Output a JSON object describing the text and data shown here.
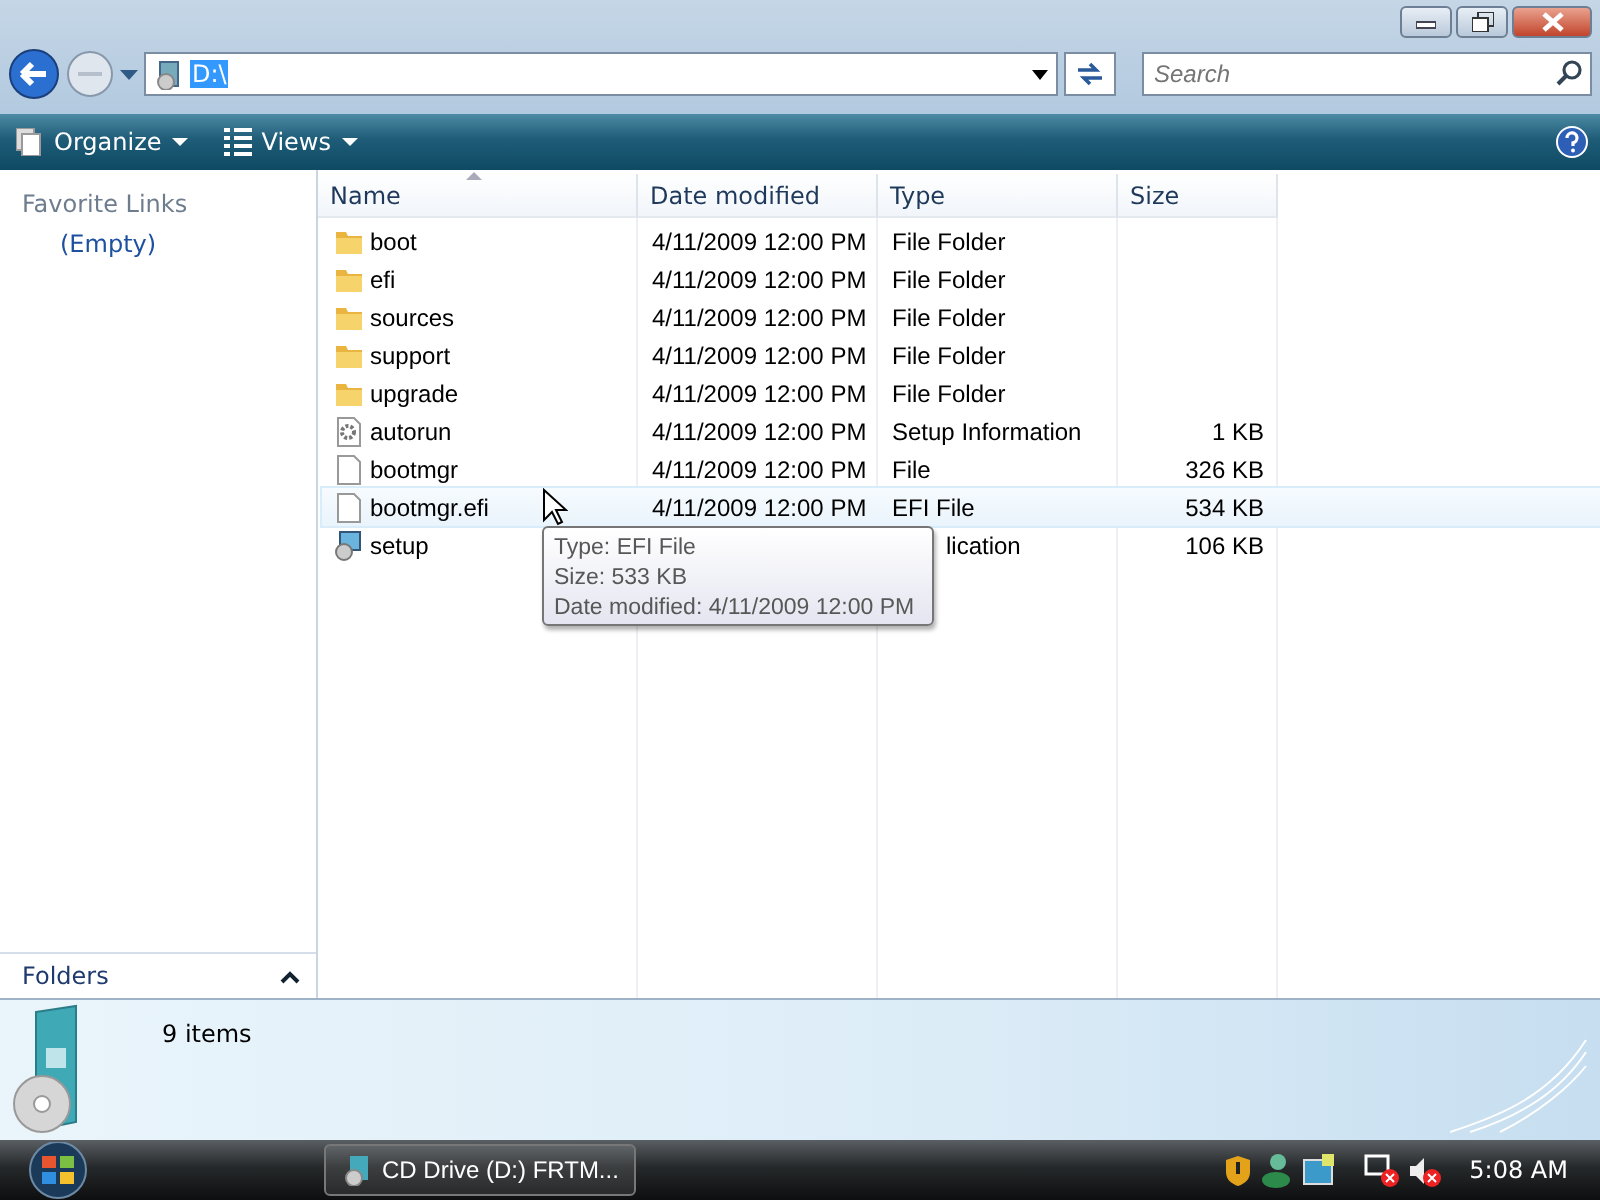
{
  "address": {
    "value": "D:\\"
  },
  "search": {
    "placeholder": "Search"
  },
  "toolbar": [
    {
      "label": "Organize",
      "kind": "organize"
    },
    {
      "label": "Views",
      "kind": "views"
    }
  ],
  "nav": {
    "heading": "Favorite Links",
    "items": [
      "(Empty)"
    ],
    "folders_label": "Folders"
  },
  "table": {
    "columns": [
      "Name",
      "Date modified",
      "Type",
      "Size"
    ],
    "rows": [
      {
        "name": "boot",
        "kind": "folder",
        "date": "4/11/2009 12:00 PM",
        "type": "File Folder",
        "hovered": false
      },
      {
        "name": "efi",
        "kind": "folder",
        "date": "4/11/2009 12:00 PM",
        "type": "File Folder",
        "hovered": false
      },
      {
        "name": "sources",
        "kind": "folder",
        "date": "4/11/2009 12:00 PM",
        "type": "File Folder",
        "hovered": false
      },
      {
        "name": "support",
        "kind": "folder",
        "date": "4/11/2009 12:00 PM",
        "type": "File Folder",
        "hovered": false
      },
      {
        "name": "upgrade",
        "kind": "folder",
        "date": "4/11/2009 12:00 PM",
        "type": "File Folder",
        "hovered": false
      },
      {
        "name": "autorun",
        "kind": "settings",
        "date": "4/11/2009 12:00 PM",
        "type": "Setup Information",
        "size": "1 KB",
        "hovered": false
      },
      {
        "name": "bootmgr",
        "kind": "file",
        "date": "4/11/2009 12:00 PM",
        "type": "File",
        "size": "326 KB",
        "hovered": false
      },
      {
        "name": "bootmgr.efi",
        "kind": "file",
        "date": "4/11/2009 12:00 PM",
        "type": "EFI File",
        "size": "534 KB",
        "hovered": true
      },
      {
        "name": "setup",
        "kind": "app",
        "type": "lication",
        "size": "106 KB",
        "hovered": false
      }
    ]
  },
  "tooltip": [
    "Type: EFI File",
    "Size: 533 KB",
    "Date modified: 4/11/2009 12:00 PM"
  ],
  "details": {
    "count": "9 items"
  },
  "taskbar": {
    "task": "CD Drive (D:) FRTM...",
    "clock": "5:08 AM"
  }
}
